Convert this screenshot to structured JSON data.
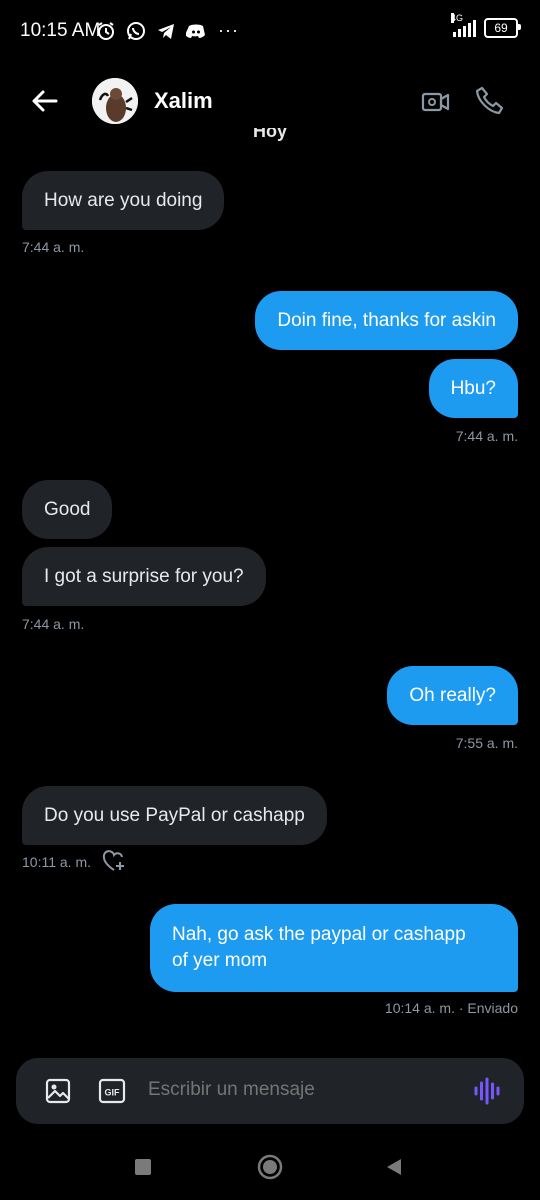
{
  "status_bar": {
    "time": "10:15 AM",
    "more": "···",
    "network": "4G",
    "battery": "69"
  },
  "header": {
    "contact_name": "Xalim"
  },
  "date_separator": "Hoy",
  "messages": [
    {
      "side": "in",
      "text": "How are you doing",
      "time": "7:44 a. m."
    },
    {
      "side": "out",
      "text": "Doin fine, thanks for askin"
    },
    {
      "side": "out",
      "text": "Hbu?",
      "time": "7:44 a. m."
    },
    {
      "side": "in",
      "text": "Good"
    },
    {
      "side": "in",
      "text": "I got a surprise for you?",
      "time": "7:44 a. m."
    },
    {
      "side": "out",
      "text": "Oh really?",
      "time": "7:55 a. m."
    },
    {
      "side": "in",
      "text": "Do you use PayPal or cashapp",
      "time": "10:11 a. m."
    },
    {
      "side": "out",
      "text_line1": "Nah, go ask the paypal or cashapp",
      "text_line2": "of yer mom",
      "time": "10:14 a. m. · Enviado"
    }
  ],
  "composer": {
    "placeholder": "Escribir un mensaje",
    "gif_label": "GIF"
  },
  "colors": {
    "outgoing_bubble": "#1d9bf0",
    "incoming_bubble": "#202327",
    "voice_accent": "#7856ff"
  }
}
